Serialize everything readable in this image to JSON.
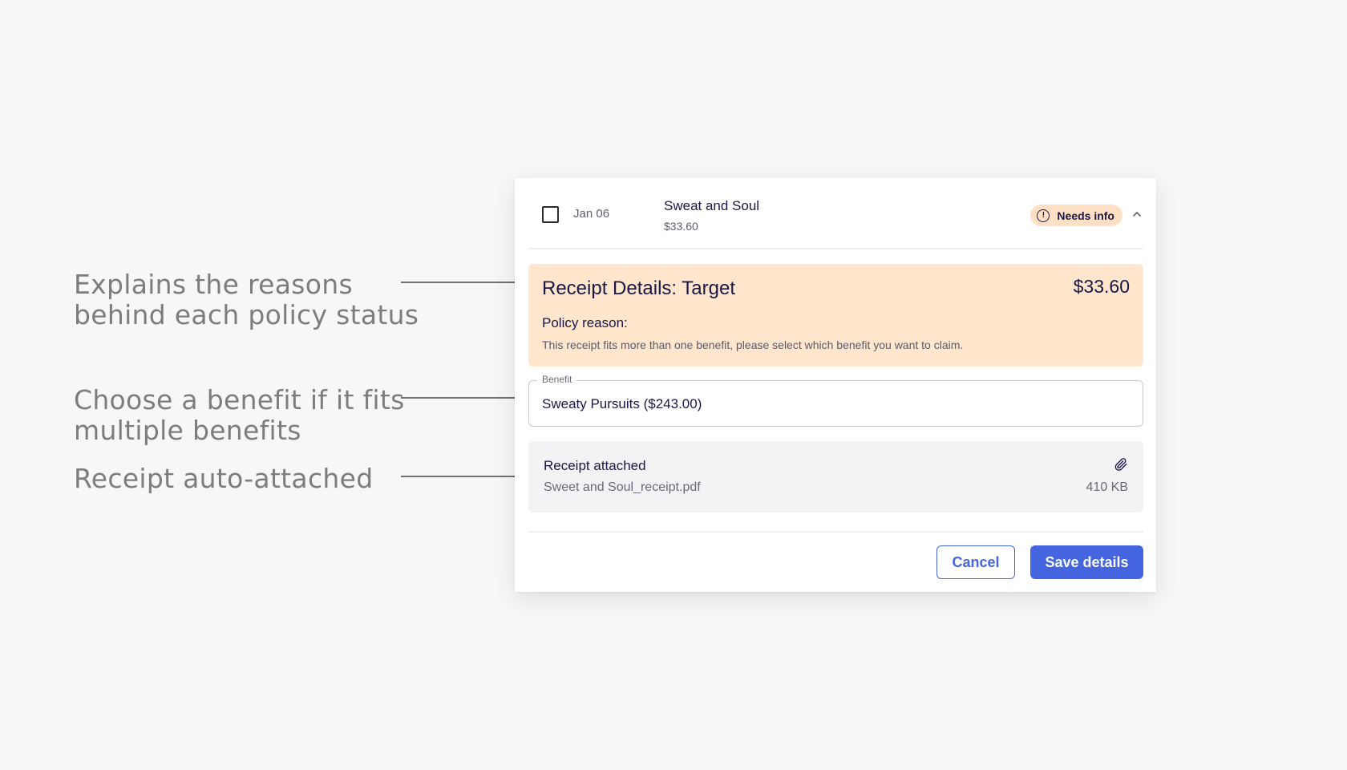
{
  "annotations": [
    {
      "line1": "Explains the reasons",
      "line2": "behind each policy status"
    },
    {
      "line1": "Choose a benefit if it fits",
      "line2": "multiple benefits"
    },
    {
      "line1": "Receipt auto-attached"
    }
  ],
  "expense_row": {
    "date": "Jan 06",
    "merchant": "Sweat and Soul",
    "amount": "$33.60",
    "status": "Needs info",
    "status_icon": "alert-circle-icon",
    "expand_icon": "chevron-up-icon"
  },
  "receipt_details": {
    "title": "Receipt Details: Target",
    "amount": "$33.60",
    "policy_label": "Policy reason:",
    "policy_text": "This receipt fits more than one benefit, please select which benefit you want to claim."
  },
  "benefit_field": {
    "label": "Benefit",
    "value": "Sweaty Pursuits ($243.00)"
  },
  "attachment": {
    "title": "Receipt attached",
    "filename": "Sweet and Soul_receipt.pdf",
    "size": "410 KB",
    "icon": "paperclip-icon"
  },
  "actions": {
    "cancel_label": "Cancel",
    "save_label": "Save details"
  },
  "colors": {
    "background": "#f7f7f7",
    "accent": "#4565e0",
    "warning_bg": "#ffe6cc",
    "badge_bg": "#ffe0c4",
    "text_primary": "#1a1646",
    "annotation_text": "#7d7d7d"
  }
}
